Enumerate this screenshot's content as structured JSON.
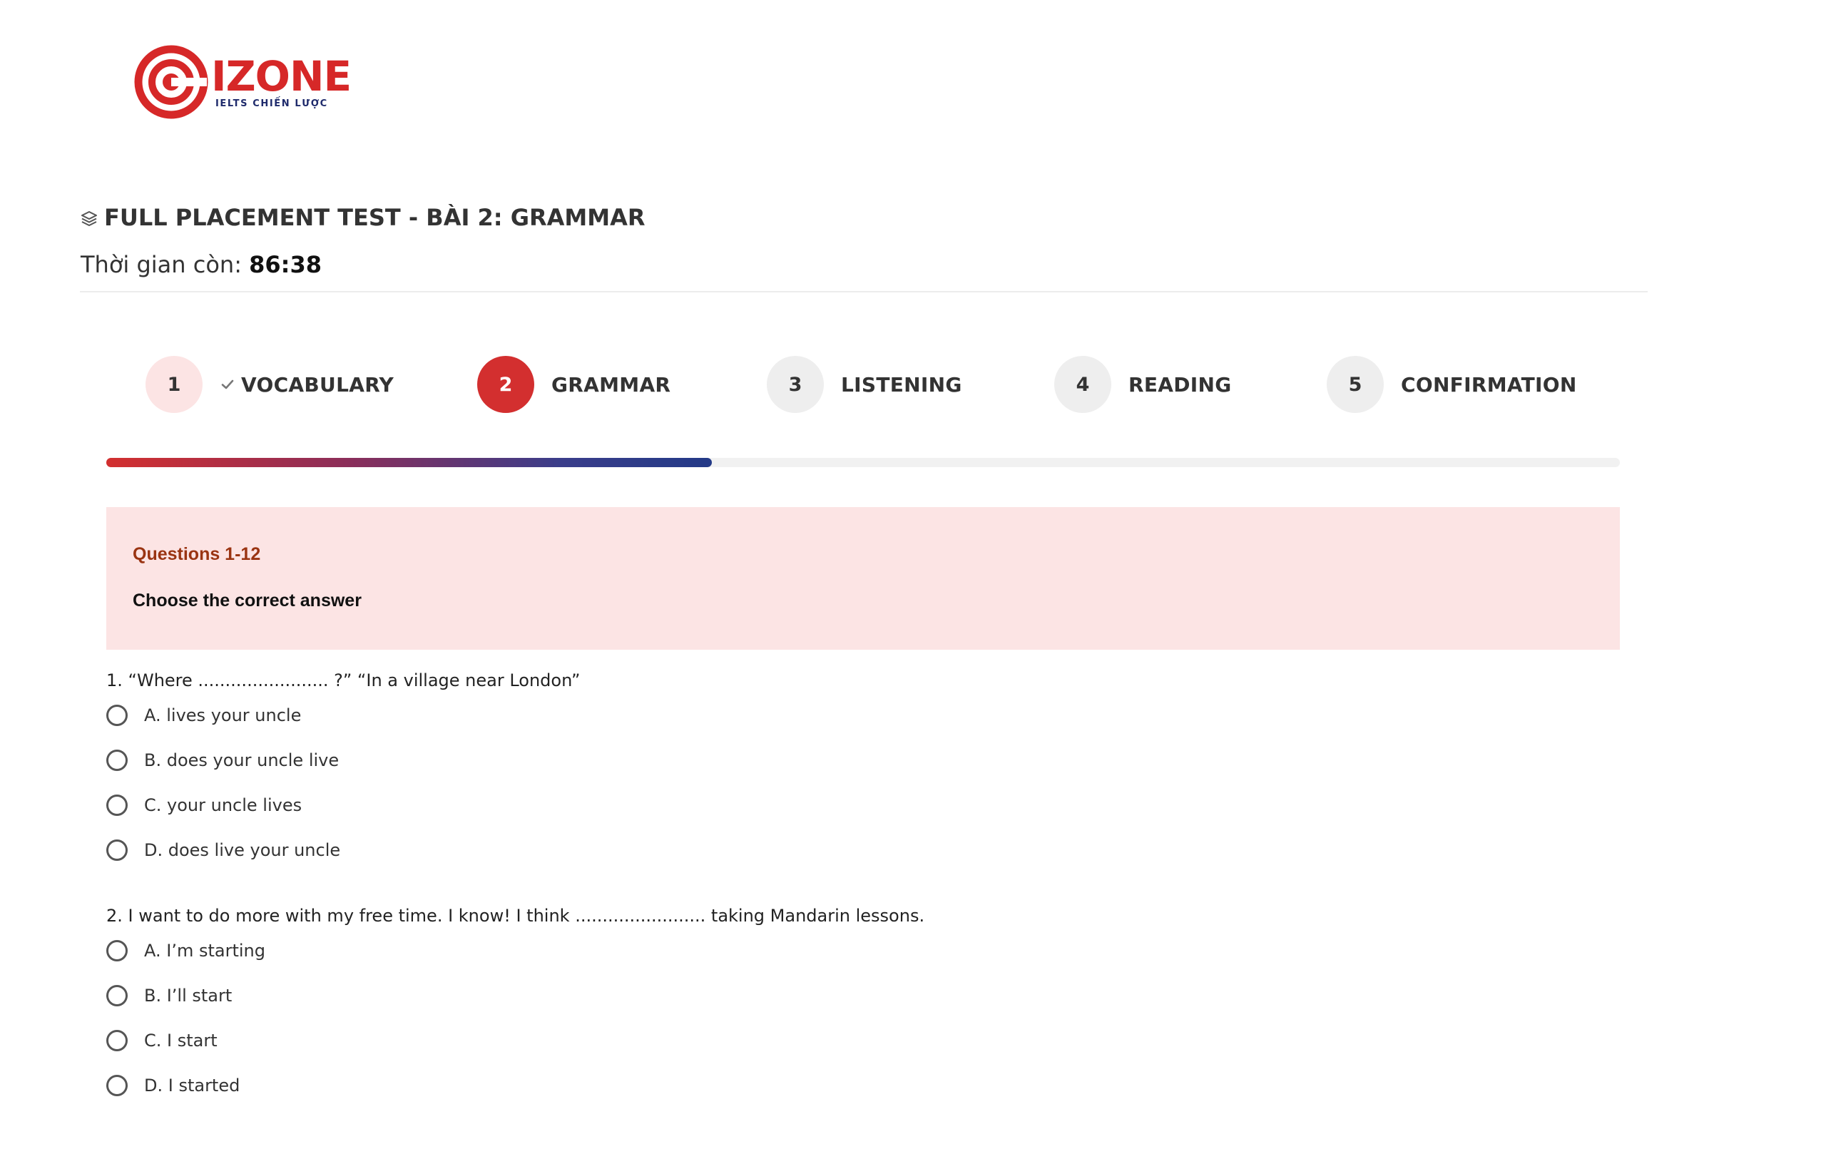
{
  "brand": {
    "name": "IZONE",
    "tagline": "IELTS CHIẾN LƯỢC",
    "colors": {
      "red": "#d62828",
      "navy": "#1e2a6b"
    }
  },
  "header": {
    "title_icon": "layers-icon",
    "title": "FULL PLACEMENT TEST - BÀI 2: GRAMMAR",
    "timer_label": "Thời gian còn: ",
    "timer_value": "86:38"
  },
  "steps": [
    {
      "number": "1",
      "label": "VOCABULARY",
      "state": "done",
      "icon": "check-icon"
    },
    {
      "number": "2",
      "label": "GRAMMAR",
      "state": "active"
    },
    {
      "number": "3",
      "label": "LISTENING",
      "state": "pending"
    },
    {
      "number": "4",
      "label": "READING",
      "state": "pending"
    },
    {
      "number": "5",
      "label": "CONFIRMATION",
      "state": "pending"
    }
  ],
  "progress": {
    "fraction": 0.4
  },
  "instructions": {
    "range": "Questions 1-12",
    "text": "Choose the correct answer"
  },
  "questions": [
    {
      "text": "1. “Where ........................ ?” “In a village near London”",
      "options": [
        "A. lives your uncle",
        "B. does your uncle live",
        "C. your uncle lives",
        "D. does live your uncle"
      ]
    },
    {
      "text": "2. I want to do more with my free time. I know! I think ........................ taking Mandarin lessons.",
      "options": [
        "A. I’m starting",
        "B. I’ll start",
        "C. I start",
        "D. I started"
      ]
    }
  ],
  "colors": {
    "accent": "#d32f2f",
    "done_step_bg": "#fce4e4",
    "pending_step_bg": "#eeeeee",
    "instructions_bg": "#fce4e4",
    "questions_range": "#9a3412"
  }
}
